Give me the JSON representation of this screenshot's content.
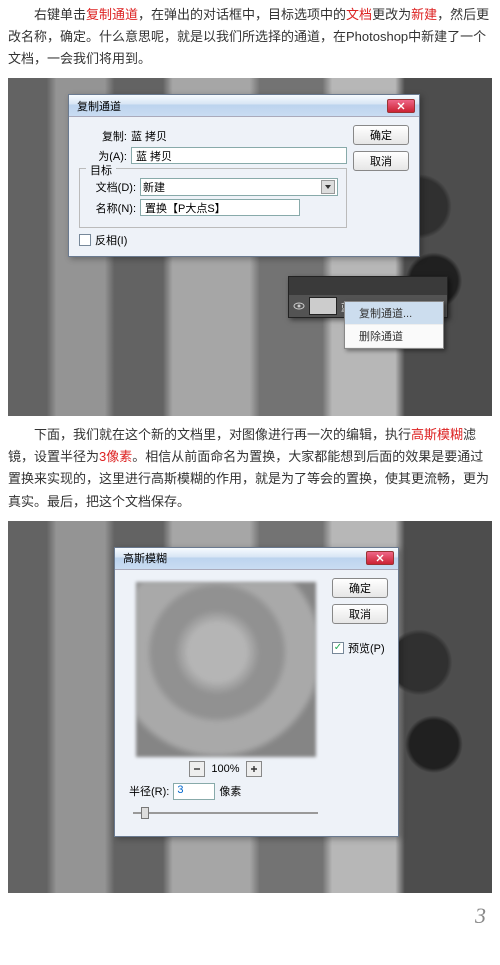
{
  "para1": {
    "t1": "右键单击",
    "t2": "复制通道",
    "t3": "，在弹出的对话框中，目标选项中的",
    "t4": "文档",
    "t5": "更改为",
    "t6": "新建",
    "t7": "，然后更改名称，确定。什么意思呢，就是以我们所选择的通道，在Photoshop中新建了一个文档，一会我们将用到。"
  },
  "dlg1": {
    "title": "复制通道",
    "copy_lbl": "复制:",
    "copy_val": "蓝 拷贝",
    "as_lbl": "为(A):",
    "as_val": "蓝 拷贝",
    "target_lbl": "目标",
    "doc_lbl": "文档(D):",
    "doc_val": "新建",
    "name_lbl": "名称(N):",
    "name_val": "置换【P大点S】",
    "invert_lbl": "反相(I)",
    "ok": "确定",
    "cancel": "取消"
  },
  "ctx": {
    "header": "蓝 拷贝",
    "item1": "复制通道...",
    "item2": "删除通道"
  },
  "para2": {
    "t1": "下面，我们就在这个新的文档里，对图像进行再一次的编辑，执行",
    "t2": "高斯模糊",
    "t3": "滤镜，设置半径为",
    "t4": "3像素",
    "t5": "。相信从前面命名为置换，大家都能想到后面的效果是要通过置换来实现的，这里进行高斯模糊的作用，就是为了等会的置换，使其更流畅，更为真实。最后，把这个文档保存。"
  },
  "dlg2": {
    "title": "高斯模糊",
    "ok": "确定",
    "cancel": "取消",
    "preview_lbl": "预览(P)",
    "zoom": "100%",
    "radius_lbl": "半径(R):",
    "radius_val": "3",
    "radius_unit": "像素"
  },
  "page_num": "3"
}
